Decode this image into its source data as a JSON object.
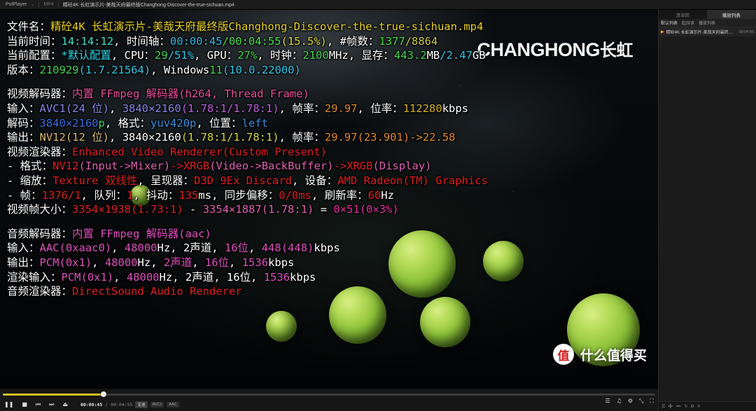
{
  "titlebar": {
    "app": "PotPlayer",
    "caret": "⌄",
    "filetype": "MP4",
    "filename": "精砼4K 长虹演示片-美哉天府最终版Changhong-Discover-the-true-sichuan.mp4"
  },
  "osd": {
    "filename_label": "文件名：",
    "filename_value": "精砼4K 长虹演示片-美哉天府最终版Changhong-Discover-the-true-sichuan.mp4",
    "time_label": "当前时间：",
    "time_value": "14:14:12",
    "timeline_label": "时间轴：",
    "timeline_cur": "00:00:45",
    "timeline_slash": "/",
    "timeline_total": "00:04:55",
    "timeline_pct": "(15.5%)",
    "frames_label": "#帧数：",
    "frames_cur": "1377",
    "frames_total": "/8864",
    "config_label": "当前配置：",
    "config_value": "*默认配置",
    "cpu_label": "CPU：",
    "cpu_a": "29",
    "cpu_b": "/51%",
    "gpu_label": "GPU：",
    "gpu_value": "27%",
    "clock_label": "时钟：",
    "clock_value": "2100",
    "clock_unit": "MHz",
    "vram_label": "显存：",
    "vram_used": "443.2",
    "vram_used_unit": "MB",
    "vram_total": "/2.47",
    "vram_total_unit": "GB",
    "version_label": "版本：",
    "version_build": "210929",
    "version_num": "(1.7.21564)",
    "os_label": "Windows",
    "os_ver": "11",
    "os_build": "(10.0.22000)",
    "vdec_label": "视频解码器：",
    "vdec_value": "内置 FFmpeg 解码器(h264, Thread Frame)",
    "vin_label": "输入：",
    "vin_codec": "AVC1(24 位)",
    "vin_res": "3840×2160",
    "vin_ar": "(1.78:1/1.78:1)",
    "vin_fps_label": "帧率：",
    "vin_fps": "29.97",
    "vin_br_label": "位率：",
    "vin_br": "112280",
    "vin_br_unit": "kbps",
    "vdecode_label": "解码：",
    "vdecode_res": "3840×2160",
    "vdecode_p": "p",
    "vfmt_label": "格式：",
    "vfmt_value": "yuv420p",
    "vpos_label": "位置：",
    "vpos_value": "left",
    "vout_label": "输出：",
    "vout_codec": "NV12(12 位)",
    "vout_res": "3840×2160",
    "vout_ar": "(1.78:1/1.78:1)",
    "vout_fps_label": "帧率：",
    "vout_fps": "29.97(23.901)->22.58",
    "vrend_label": "视频渲染器：",
    "vrend_value": "Enhanced Video Renderer(Custom Present)",
    "vr_fmt_label": "- 格式：",
    "vr_fmt_a": "NV12",
    "vr_fmt_a2": "(Input->Mixer)",
    "vr_arrow1": "->",
    "vr_fmt_b": "XRGB",
    "vr_fmt_b2": "(Video->BackBuffer)",
    "vr_arrow2": "->",
    "vr_fmt_c": "XRGB",
    "vr_fmt_c2": "(Display)",
    "vr_scale_label": "- 缩放：",
    "vr_scale_value": "Texture 双线性",
    "vr_present_label": "呈现器：",
    "vr_present_value": "D3D 9Ex Discard",
    "vr_device_label": "设备：",
    "vr_device_value": "AMD Radeon(TM) Graphics",
    "vr_frame_label": "- 帧：",
    "vr_frame_value": "1376/1",
    "vr_queue_label": "队列：",
    "vr_queue_value": "1",
    "vr_jitter_label": "抖动：",
    "vr_jitter_value": "135",
    "vr_jitter_unit": "ms",
    "vr_sync_label": "同步偏移：",
    "vr_sync_value": "0/0ms",
    "vr_refresh_label": "刷新率：",
    "vr_refresh_value": "60",
    "vr_refresh_unit": "Hz",
    "vsize_label": "视频帧大小：",
    "vsize_a": "3354×1938",
    "vsize_a_ar": "(1.73:1)",
    "vsize_minus": "-",
    "vsize_b": "3354×1887",
    "vsize_b_ar": "(1.78:1)",
    "vsize_eq": "=",
    "vsize_diff": "0×51",
    "vsize_pct": "(0×3%)",
    "adec_label": "音频解码器：",
    "adec_value": "内置 FFmpeg 解码器(aac)",
    "ain_label": "输入：",
    "ain_codec": "AAC(0xaac0)",
    "ain_rate": "48000",
    "ain_rate_unit": "Hz",
    "ain_ch": "2声道",
    "ain_bits": "16位",
    "ain_br": "448(448)",
    "ain_br_unit": "kbps",
    "aout_label": "输出：",
    "aout_codec": "PCM(0x1)",
    "aout_rate": "48000",
    "aout_rate_unit": "Hz",
    "aout_ch": "2声道",
    "aout_bits": "16位",
    "aout_br": "1536",
    "aout_br_unit": "kbps",
    "arin_label": "渲染输入：",
    "arin_codec": "PCM(0x1)",
    "arin_rate": "48000",
    "arin_rate_unit": "Hz",
    "arin_ch": "2声道",
    "arin_bits": "16位",
    "arin_br": "1536",
    "arin_br_unit": "kbps",
    "arend_label": "音频渲染器：",
    "arend_value": "DirectSound Audio Renderer"
  },
  "watermark": {
    "brand_en": "CHANGHONG",
    "brand_cn": "长虹",
    "zdm_badge": "值",
    "zdm_text": "什么值得买"
  },
  "playlist": {
    "tabs": [
      {
        "label": "清单简",
        "active": false
      },
      {
        "label": "播放列表",
        "active": true
      }
    ],
    "tools": [
      "默认列表",
      "起庌读",
      "播放列表"
    ],
    "items": [
      {
        "play": "▶",
        "name": "精砼4K 长虹演示片-美哉天府最终版Ch...",
        "dur": "00:04:55"
      }
    ],
    "footer_icons": [
      "☰",
      "➕",
      "➖",
      "↻",
      "⚙",
      "✕"
    ]
  },
  "controls": {
    "progress_pct": 15.5,
    "buttons": [
      {
        "icon": "❚❚",
        "name": "pause-button"
      },
      {
        "icon": "■",
        "name": "stop-button"
      },
      {
        "icon": "⏮",
        "name": "previous-button"
      },
      {
        "icon": "⏭",
        "name": "next-button"
      },
      {
        "icon": "⏏",
        "name": "eject-button"
      }
    ],
    "current_time": "00:00:45",
    "separator": "/",
    "total_time": "00:04:55",
    "chips": [
      "变速",
      "AVC1",
      "AAC"
    ],
    "right_icons": [
      "☰",
      "♫",
      "⚙",
      "⤡",
      "⛶"
    ]
  }
}
